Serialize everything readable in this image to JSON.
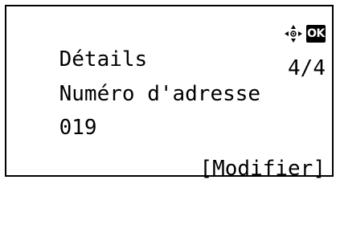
{
  "screen": {
    "title": "Détails",
    "field_label": "Numéro d'adresse",
    "page_indicator": "4/4",
    "value": "019",
    "ok_label": "OK",
    "softkey": "[Modifier]"
  },
  "icons": {
    "navigation": "arrow-keys-icon",
    "ok": "ok-key-icon"
  },
  "colors": {
    "text": "#000000",
    "background": "#ffffff"
  }
}
